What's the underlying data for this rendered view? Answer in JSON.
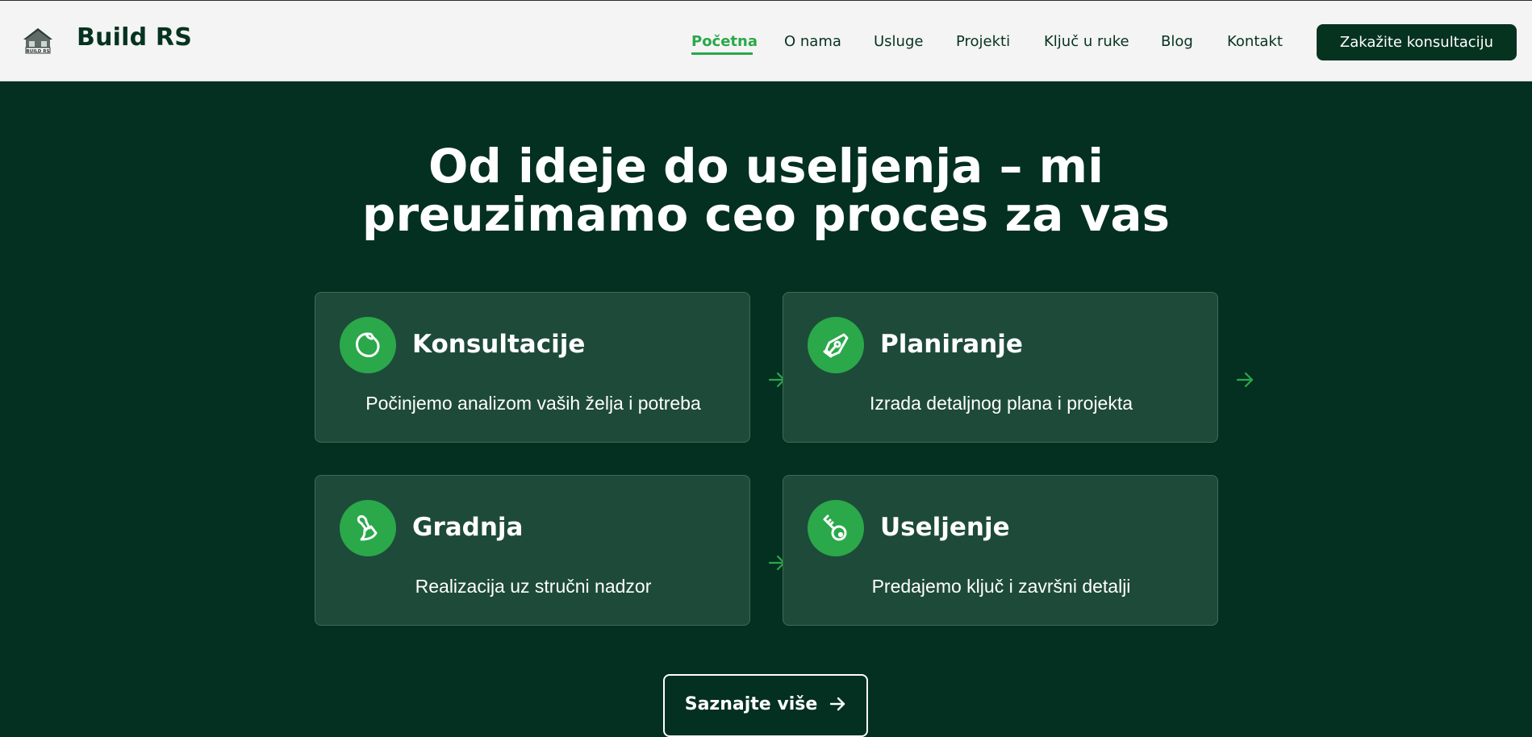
{
  "header": {
    "brand": "Build RS",
    "logo_text": "BUILD RS",
    "nav": [
      {
        "label": "Početna",
        "active": true
      },
      {
        "label": "O nama",
        "active": false
      },
      {
        "label": "Usluge",
        "active": false
      },
      {
        "label": "Projekti",
        "active": false
      },
      {
        "label": "Ključ u ruke",
        "active": false
      },
      {
        "label": "Blog",
        "active": false
      },
      {
        "label": "Kontakt",
        "active": false
      }
    ],
    "cta_label": "Zakažite konsultaciju"
  },
  "hero": {
    "title_line1": "Od ideje do useljenja – mi",
    "title_line2": "preuzimamo ceo proces za vas"
  },
  "steps": [
    {
      "title": "Konsultacije",
      "description": "Počinjemo analizom vaših želja i potreba",
      "icon": "leaf-icon"
    },
    {
      "title": "Planiranje",
      "description": "Izrada detaljnog plana i projekta",
      "icon": "pen-nib-icon"
    },
    {
      "title": "Gradnja",
      "description": "Realizacija uz stručni nadzor",
      "icon": "brush-icon"
    },
    {
      "title": "Useljenje",
      "description": "Predajemo ključ i završni detalji",
      "icon": "key-icon"
    }
  ],
  "more_button": {
    "label": "Saznajte više",
    "icon": "arrow-right-icon"
  },
  "colors": {
    "accent": "#2aa84a",
    "dark_green": "#033020",
    "card_bg": "#1e4a3a",
    "header_bg": "#f4f4f4"
  }
}
